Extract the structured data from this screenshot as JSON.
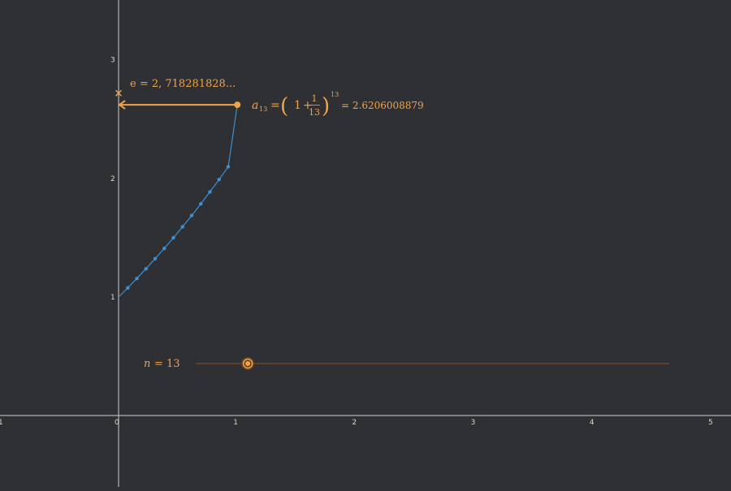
{
  "chart_data": {
    "type": "scatter",
    "title": "",
    "xlabel": "",
    "ylabel": "",
    "xlim": [
      -1,
      5
    ],
    "ylim": [
      -0.6,
      3.5
    ],
    "grid": false,
    "x_ticks": [
      "-1",
      "0",
      "1",
      "2",
      "3",
      "4",
      "5"
    ],
    "y_ticks": [
      "1",
      "2",
      "3"
    ],
    "series": [
      {
        "x": [
          0,
          0.0769,
          0.1538,
          0.2308,
          0.3077,
          0.3846,
          0.4615,
          0.5385,
          0.6154,
          0.6923,
          0.7692,
          0.8462,
          0.9231,
          1
        ],
        "y": [
          1,
          1.0769,
          1.1563,
          1.2382,
          1.3226,
          1.4096,
          1.4993,
          1.5917,
          1.6869,
          1.7851,
          1.8862,
          1.9905,
          2.0979,
          2.6206
        ]
      }
    ],
    "curve_fn": "(1+x/13)^13",
    "marker_e": {
      "x": 0,
      "y": 2.718281828,
      "label": "e = 2, 718281828..."
    },
    "point_an": {
      "x": 1,
      "y": 2.6206008879
    },
    "arrow": {
      "from": [
        1,
        2.6206008879
      ],
      "to": [
        0,
        2.6206008879
      ]
    },
    "formula": {
      "lhs": "a",
      "lhs_sub": "13",
      "eq": "=",
      "lparen": "(",
      "one": "1",
      "plus": "+",
      "num": "1",
      "den": "13",
      "rparen": ")",
      "exp": "13",
      "result": "= 2.6206008879"
    },
    "slider": {
      "label_var": "n",
      "label_rest": "= 13",
      "value": 13,
      "range_fraction": 0.11
    },
    "colors": {
      "background": "#2f3033",
      "axis": "#cfcfcf",
      "curve": "#3d8fd6",
      "highlight": "#f3a347",
      "slider_track": "#6b4628"
    }
  }
}
